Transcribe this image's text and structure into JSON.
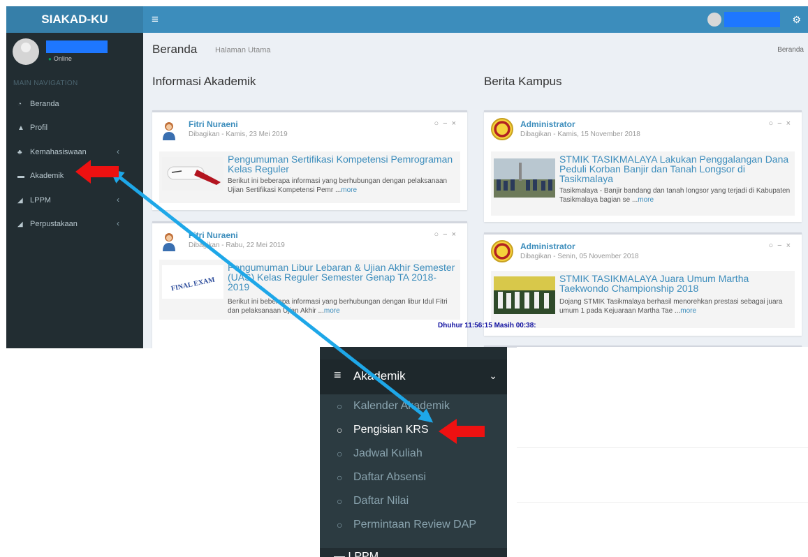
{
  "header": {
    "logo": "SIAKAD-KU",
    "toggle_icon": "hamburger-icon",
    "settings_icon": "gears-icon"
  },
  "sidebar": {
    "status": "Online",
    "nav_header": "MAIN NAVIGATION",
    "items": [
      {
        "label": "Beranda",
        "icon": "dashboard-icon"
      },
      {
        "label": "Profil",
        "icon": "user-icon"
      },
      {
        "label": "Kemahasiswaan",
        "icon": "users-icon"
      },
      {
        "label": "Akademik",
        "icon": "list-icon"
      },
      {
        "label": "LPPM",
        "icon": "book-icon"
      },
      {
        "label": "Perpustakaan",
        "icon": "book-icon"
      }
    ]
  },
  "page": {
    "title": "Beranda",
    "subtitle": "Halaman Utama",
    "breadcrumb": "Beranda"
  },
  "akademik": {
    "heading": "Informasi Akademik",
    "posts": [
      {
        "author": "Fitri Nuraeni",
        "meta": "Dibagikan - Kamis, 23 Mei 2019",
        "headline": "Pengumuman Sertifikasi Kompetensi Pemrograman Kelas Reguler",
        "excerpt": "Berikut ini beberapa informasi yang berhubungan dengan pelaksanaan Ujian Sertifikasi Kompetensi Pemr ...",
        "more": "more"
      },
      {
        "author": "Fitri Nuraeni",
        "meta": "Dibagikan - Rabu, 22 Mei 2019",
        "headline": "Pengumuman Libur Lebaran & Ujian Akhir Semester (UAS) Kelas Reguler Semester Genap TA 2018-2019",
        "excerpt": "Berikut ini beberapa informasi yang berhubungan dengan libur Idul Fitri dan pelaksanaan Ujian Akhir ...",
        "more": "more",
        "thumb_text": "FINAL EXAM"
      }
    ]
  },
  "berita": {
    "heading": "Berita Kampus",
    "posts": [
      {
        "author": "Administrator",
        "meta": "Dibagikan - Kamis, 15 November 2018",
        "headline": "STMIK TASIKMALAYA Lakukan Penggalangan Dana Peduli Korban Banjir dan Tanah Longsor di Tasikmalaya",
        "excerpt": "Tasikmalaya - Banjir bandang dan tanah longsor yang terjadi di Kabupaten Tasikmalaya bagian se ...",
        "more": "more"
      },
      {
        "author": "Administrator",
        "meta": "Dibagikan - Senin, 05 November 2018",
        "headline": "STMIK TASIKMALAYA Juara Umum Martha Taekwondo Championship 2018",
        "excerpt": "Dojang STMIK Tasikmalaya berhasil menorehkan prestasi sebagai juara umum 1 pada Kejuaraan Martha Tae ...",
        "more": "more"
      }
    ]
  },
  "clock": "Dhuhur 11:56:15  Masih 00:38:",
  "inset": {
    "active_label": "Akademik",
    "submenu": [
      {
        "label": "Kalender Akademik",
        "selected": false
      },
      {
        "label": "Pengisian KRS",
        "selected": true
      },
      {
        "label": "Jadwal Kuliah",
        "selected": false
      },
      {
        "label": "Daftar Absensi",
        "selected": false
      },
      {
        "label": "Daftar Nilai",
        "selected": false
      },
      {
        "label": "Permintaan Review DAP",
        "selected": false
      }
    ],
    "next_label": "LPPM"
  },
  "colors": {
    "topbar": "#3c8dbc",
    "sidebar": "#222d32",
    "arrow_red": "#ee1111",
    "arrow_blue": "#1ea7e8",
    "redaction": "#1e77ff"
  }
}
